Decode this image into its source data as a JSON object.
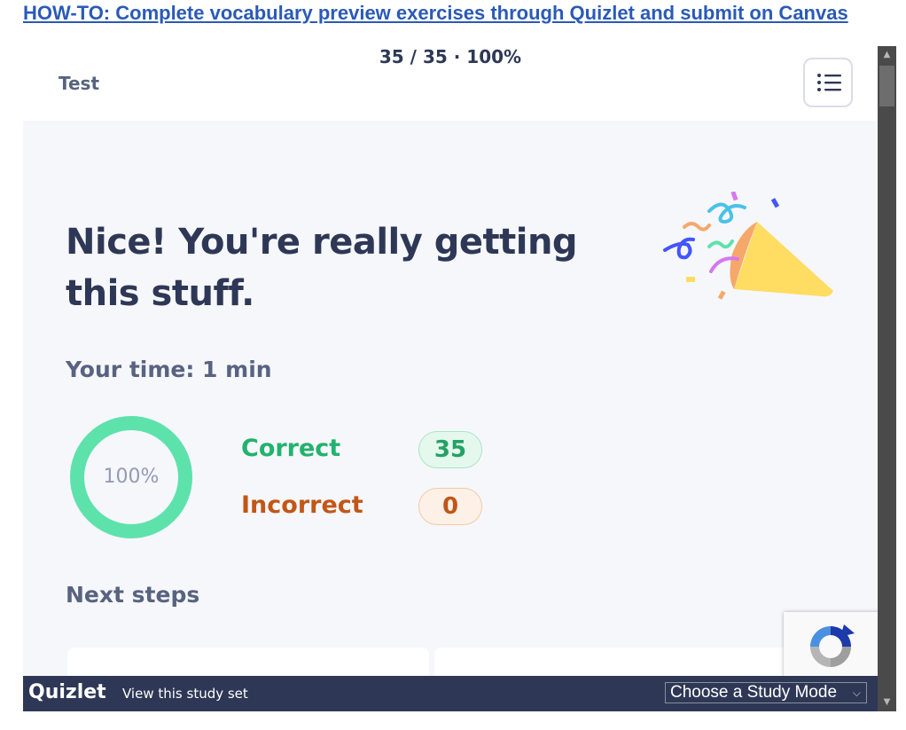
{
  "page": {
    "link_text": "HOW-TO: Complete vocabulary preview exercises through Quizlet and submit on Canvas"
  },
  "header": {
    "mode_label": "Test",
    "progress_text": "35 / 35 · 100%"
  },
  "results": {
    "headline": "Nice! You're really getting this stuff.",
    "time_label": "Your time: 1 min",
    "score_percent_text": "100%",
    "score_fraction": 1.0,
    "correct_label": "Correct",
    "correct_count": "35",
    "incorrect_label": "Incorrect",
    "incorrect_count": "0",
    "next_steps_label": "Next steps"
  },
  "footer": {
    "logo": "Quizlet",
    "view_set_link": "View this study set",
    "study_mode_select": "Choose a Study Mode"
  },
  "colors": {
    "accent_correct": "#23b26d",
    "accent_incorrect": "#c15717",
    "donut": "#5ee2ab",
    "footer_bg": "#2e3856",
    "link": "#2a5ab8"
  },
  "icons": {
    "menu": "list-menu-icon",
    "confetti": "party-popper-icon",
    "recaptcha": "recaptcha-icon",
    "dropdown": "chevron-down-icon"
  }
}
